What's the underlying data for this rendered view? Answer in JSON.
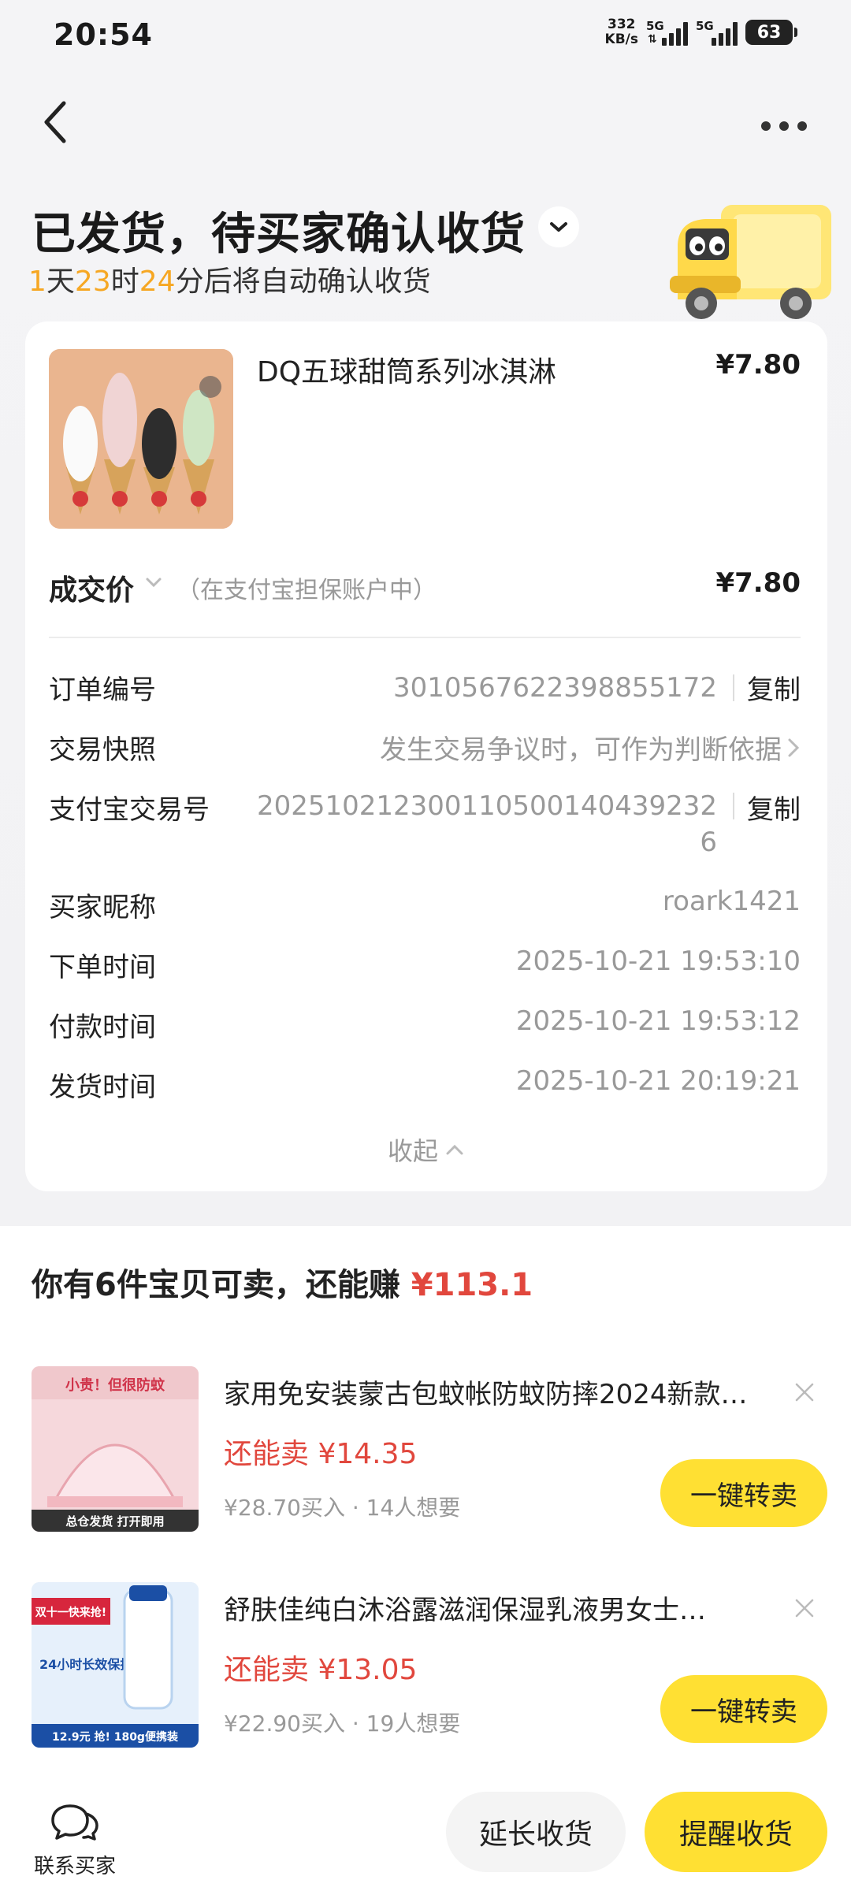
{
  "status_bar": {
    "time": "20:54",
    "net_speed_value": "332",
    "net_speed_unit": "KB/s",
    "sim1_label": "5G",
    "sim2_label": "5G",
    "battery": "63"
  },
  "nav": {
    "back_icon": "chevron-left-icon",
    "more_icon": "more-horizontal-icon"
  },
  "header": {
    "title": "已发货，待买家确认收货",
    "countdown_days": "1",
    "countdown_days_unit": "天",
    "countdown_hours": "23",
    "countdown_hours_unit": "时",
    "countdown_minutes": "24",
    "countdown_suffix": "分后将自动确认收货"
  },
  "product": {
    "title": "DQ五球甜筒系列冰淇淋",
    "price": "¥7.80"
  },
  "deal": {
    "label": "成交价",
    "note": "（在支付宝担保账户中）",
    "price": "¥7.80"
  },
  "order_info": {
    "order_no_label": "订单编号",
    "order_no": "3010567622398855172",
    "copy_label": "复制",
    "snapshot_label": "交易快照",
    "snapshot_value": "发生交易争议时，可作为判断依据",
    "alipay_label": "支付宝交易号",
    "alipay_no_line1": "20251021230011050014043923​2",
    "alipay_no_line2": "6",
    "buyer_label": "买家昵称",
    "buyer_value": "roark1421",
    "order_time_label": "下单时间",
    "order_time": "2025-10-21 19:53:10",
    "pay_time_label": "付款时间",
    "pay_time": "2025-10-21 19:53:12",
    "ship_time_label": "发货时间",
    "ship_time": "2025-10-21 20:19:21",
    "collapse_label": "收起"
  },
  "resell": {
    "heading_prefix": "你有6件宝贝可卖，还能赚",
    "heading_amount": "¥113.1",
    "items": [
      {
        "title": "家用免安装蒙古包蚊帐防蚊防摔2024新款…",
        "price": "还能卖 ¥14.35",
        "meta": "¥28.70买入 · 14人想要",
        "button": "一键转卖",
        "thumb_text_top": "小贵！但很防蚊",
        "thumb_text_bottom": "总仓发货 打开即用"
      },
      {
        "title": "舒肤佳纯白沐浴露滋润保湿乳液男女士…",
        "price": "还能卖 ¥13.05",
        "meta": "¥22.90买入 · 19人想要",
        "button": "一键转卖",
        "thumb_text_top": "双十一快来抢!",
        "thumb_text_mid": "24小时长效保护",
        "thumb_text_bottom": "12.9元 抢! 180g便携装"
      }
    ]
  },
  "bottom_bar": {
    "contact_label": "联系买家",
    "extend_label": "延长收货",
    "remind_label": "提醒收货"
  },
  "colors": {
    "accent_yellow": "#ffe033",
    "countdown_orange": "#f6a723",
    "price_red": "#e1473d"
  }
}
